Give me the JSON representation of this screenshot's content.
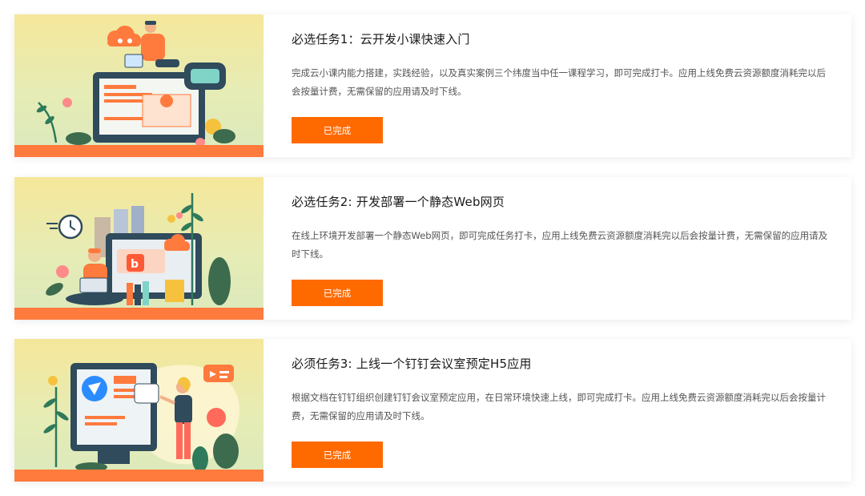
{
  "tasks": [
    {
      "title": "必选任务1：云开发小课快速入门",
      "description": "完成云小课内能力搭建，实践经验，以及真实案例三个纬度当中任一课程学习，即可完成打卡。应用上线免费云资源额度消耗完以后会按量计费，无需保留的应用请及时下线。",
      "button_label": "已完成",
      "illustration": "developer-laptop-cloud-illustration"
    },
    {
      "title": "必选任务2: 开发部署一个静态Web网页",
      "description": "在线上环境开发部署一个静态Web网页，即可完成任务打卡，应用上线免费云资源额度消耗完以后会按量计费，无需保留的应用请及时下线。",
      "button_label": "已完成",
      "illustration": "web-page-deploy-illustration"
    },
    {
      "title": "必须任务3: 上线一个钉钉会议室预定H5应用",
      "description": "根据文档在钉钉组织创建钉钉会议室预定应用，在日常环境快速上线，即可完成打卡。应用上线免费云资源额度消耗完以后会按量计费，无需保留的应用请及时下线。",
      "button_label": "已完成",
      "illustration": "dingtalk-meeting-app-illustration"
    }
  ],
  "colors": {
    "button_bg": "#ff6a00",
    "illustration_base": "#ff7a3d",
    "title_text": "#1a1a1a",
    "desc_text": "#555555"
  }
}
